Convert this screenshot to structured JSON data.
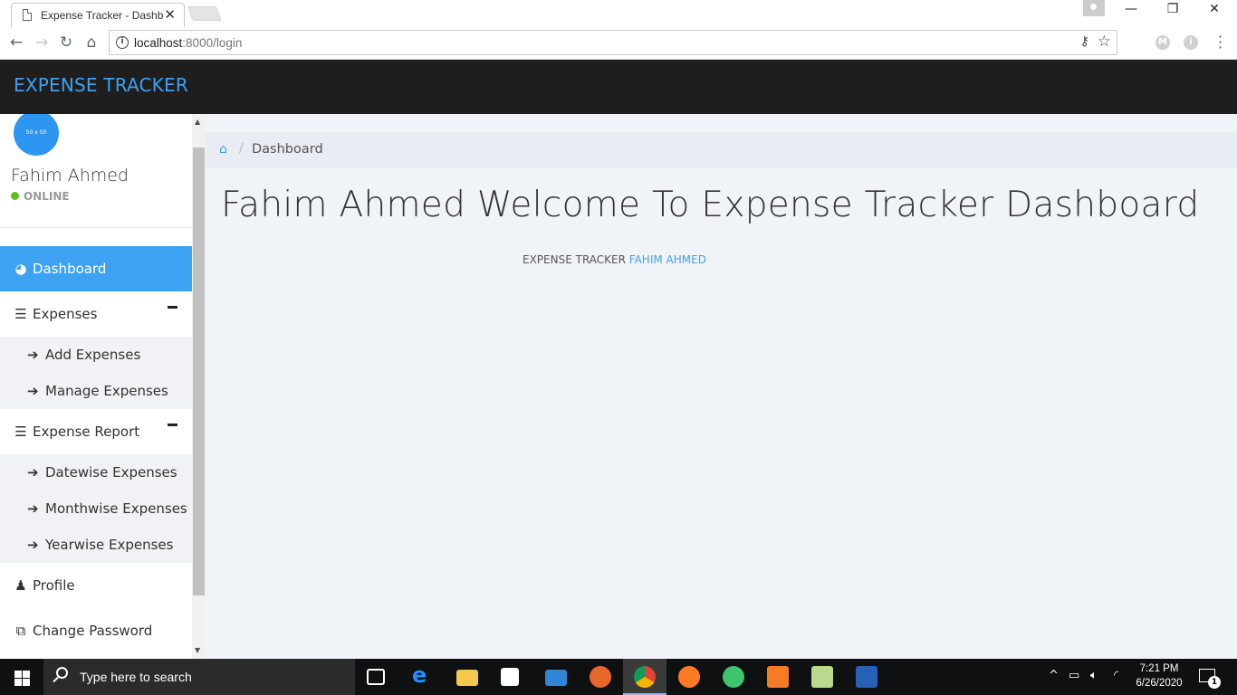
{
  "browser": {
    "tab_title": "Expense Tracker - Dashboard",
    "tab_close": "✕",
    "url_host": "localhost",
    "url_path": ":8000/login",
    "window_minimize": "—",
    "window_restore": "❐",
    "window_close": "✕",
    "ext_m": "M",
    "ext_i": "i"
  },
  "navbar": {
    "brand": "EXPENSE TRACKER"
  },
  "sidebar": {
    "avatar_label": "50 x 50",
    "user_name": "Fahim Ahmed",
    "status": "ONLINE",
    "items": {
      "dashboard": "Dashboard",
      "expenses": "Expenses",
      "add_expenses": "Add Expenses",
      "manage_expenses": "Manage Expenses",
      "expense_report": "Expense Report",
      "datewise": "Datewise Expenses",
      "monthwise": "Monthwise Expenses",
      "yearwise": "Yearwise Expenses",
      "profile": "Profile",
      "change_password": "Change Password"
    }
  },
  "main": {
    "breadcrumb": "Dashboard",
    "welcome": "Fahim Ahmed Welcome To Expense Tracker Dashboard",
    "footer_prefix": "EXPENSE TRACKER",
    "footer_name": "FAHIM AHMED"
  },
  "taskbar": {
    "search_placeholder": "Type here to search",
    "time": "7:21 PM",
    "date": "6/26/2020",
    "notification_count": "1"
  },
  "colors": {
    "accent": "#3da2f1",
    "navbar_bg": "#1e1e1e",
    "online": "#5cc220",
    "content_bg": "#f0f3f7"
  }
}
